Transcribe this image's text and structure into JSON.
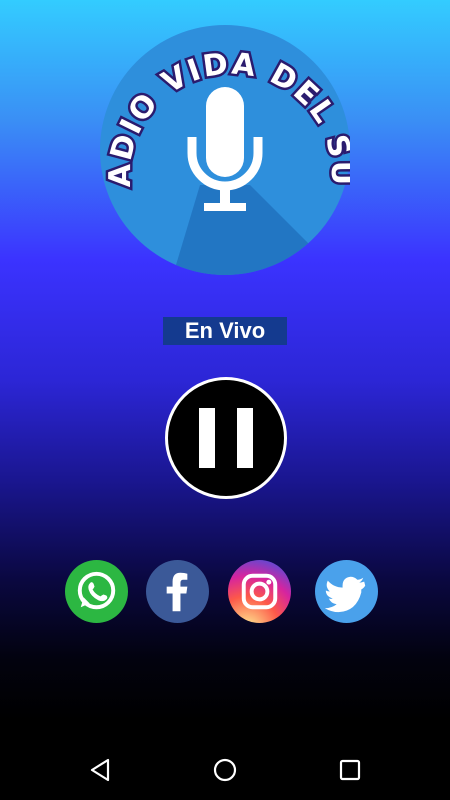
{
  "logo": {
    "text": "RADIO VIDA DEL SUR",
    "icon": "microphone-icon"
  },
  "status": {
    "label": "En Vivo"
  },
  "player": {
    "state": "playing",
    "button_icon": "pause-icon"
  },
  "social": [
    {
      "name": "whatsapp",
      "icon": "whatsapp-icon",
      "color": "#2cb742"
    },
    {
      "name": "facebook",
      "icon": "facebook-icon",
      "color": "#3b5998"
    },
    {
      "name": "instagram",
      "icon": "instagram-icon",
      "color": "#d6249f"
    },
    {
      "name": "twitter",
      "icon": "twitter-icon",
      "color": "#4aa1eb"
    }
  ],
  "navbar": {
    "items": [
      "back-icon",
      "home-icon",
      "recents-icon"
    ]
  }
}
